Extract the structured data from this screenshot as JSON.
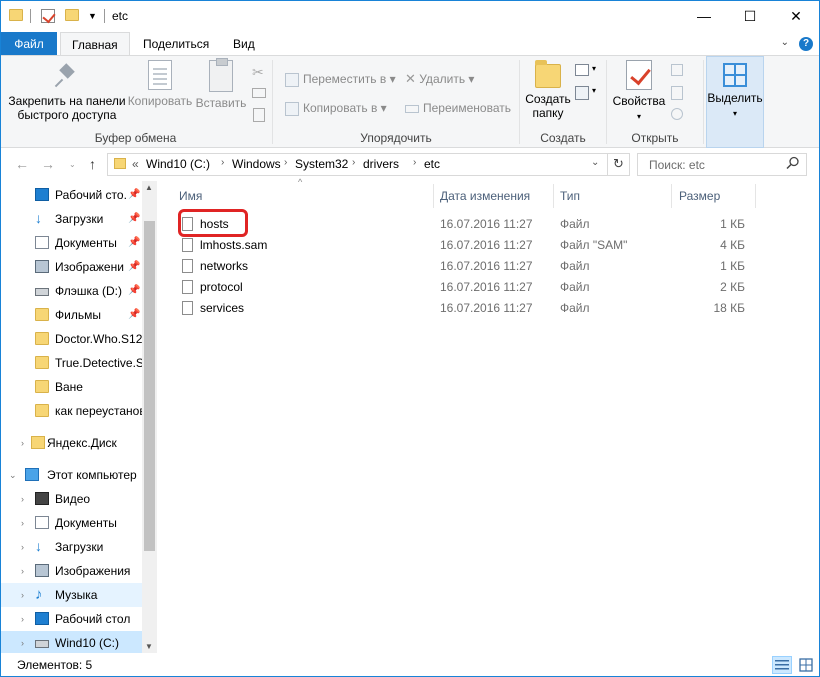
{
  "window": {
    "title": "etc",
    "controls": {
      "minimize": "—",
      "maximize": "☐",
      "close": "✕"
    }
  },
  "ribbon_tabs": [
    "Файл",
    "Главная",
    "Поделиться",
    "Вид"
  ],
  "ribbon": {
    "clipboard": {
      "pin_label_1": "Закрепить на панели",
      "pin_label_2": "быстрого доступа",
      "copy": "Копировать",
      "paste": "Вставить",
      "group": "Буфер обмена"
    },
    "organize": {
      "move_to": "Переместить в",
      "copy_to": "Копировать в",
      "delete": "Удалить",
      "rename": "Переименовать",
      "group": "Упорядочить"
    },
    "new": {
      "new_folder_1": "Создать",
      "new_folder_2": "папку",
      "group": "Создать"
    },
    "open": {
      "properties": "Свойства",
      "group": "Открыть"
    },
    "select": {
      "label": "Выделить"
    }
  },
  "address": {
    "prefix": "«",
    "crumbs": [
      "Wind10 (C:)",
      "Windows",
      "System32",
      "drivers",
      "etc"
    ],
    "search_placeholder": "Поиск: etc"
  },
  "nav_items": [
    {
      "label": "Рабочий сто.",
      "icon": "desktop-icon",
      "pinned": true
    },
    {
      "label": "Загрузки",
      "icon": "downloads-icon",
      "pinned": true
    },
    {
      "label": "Документы",
      "icon": "documents-icon",
      "pinned": true
    },
    {
      "label": "Изображени",
      "icon": "pictures-icon",
      "pinned": true
    },
    {
      "label": "Флэшка (D:)",
      "icon": "usb-drive-icon",
      "pinned": true
    },
    {
      "label": "Фильмы",
      "icon": "folder-icon",
      "pinned": true
    },
    {
      "label": "Doctor.Who.S12",
      "icon": "folder-icon",
      "pinned": false
    },
    {
      "label": "True.Detective.S(",
      "icon": "folder-icon",
      "pinned": false
    },
    {
      "label": "Ване",
      "icon": "folder-icon",
      "pinned": false
    },
    {
      "label": "как переустанов",
      "icon": "folder-icon",
      "pinned": false
    },
    {
      "label": "Яндекс.Диск",
      "icon": "yandex-disk-icon",
      "pinned": false
    },
    {
      "label": "Этот компьютер",
      "icon": "computer-icon",
      "pinned": false
    },
    {
      "label": "Видео",
      "icon": "video-icon",
      "pinned": false
    },
    {
      "label": "Документы",
      "icon": "documents-icon",
      "pinned": false
    },
    {
      "label": "Загрузки",
      "icon": "downloads-icon",
      "pinned": false
    },
    {
      "label": "Изображения",
      "icon": "pictures-icon",
      "pinned": false
    },
    {
      "label": "Музыка",
      "icon": "music-icon",
      "pinned": false
    },
    {
      "label": "Рабочий стол",
      "icon": "desktop-icon",
      "pinned": false
    },
    {
      "label": "Wind10 (C:)",
      "icon": "drive-icon",
      "pinned": false
    }
  ],
  "columns": [
    "Имя",
    "Дата изменения",
    "Тип",
    "Размер"
  ],
  "files": [
    {
      "name": "hosts",
      "date": "16.07.2016 11:27",
      "type": "Файл",
      "size": "1 КБ"
    },
    {
      "name": "lmhosts.sam",
      "date": "16.07.2016 11:27",
      "type": "Файл \"SAM\"",
      "size": "4 КБ"
    },
    {
      "name": "networks",
      "date": "16.07.2016 11:27",
      "type": "Файл",
      "size": "1 КБ"
    },
    {
      "name": "protocol",
      "date": "16.07.2016 11:27",
      "type": "Файл",
      "size": "2 КБ"
    },
    {
      "name": "services",
      "date": "16.07.2016 11:27",
      "type": "Файл",
      "size": "18 КБ"
    }
  ],
  "status": {
    "item_count": "Элементов: 5"
  },
  "colors": {
    "accent": "#1979ca",
    "highlight_ring": "#e02424",
    "selection": "#cce8ff"
  }
}
